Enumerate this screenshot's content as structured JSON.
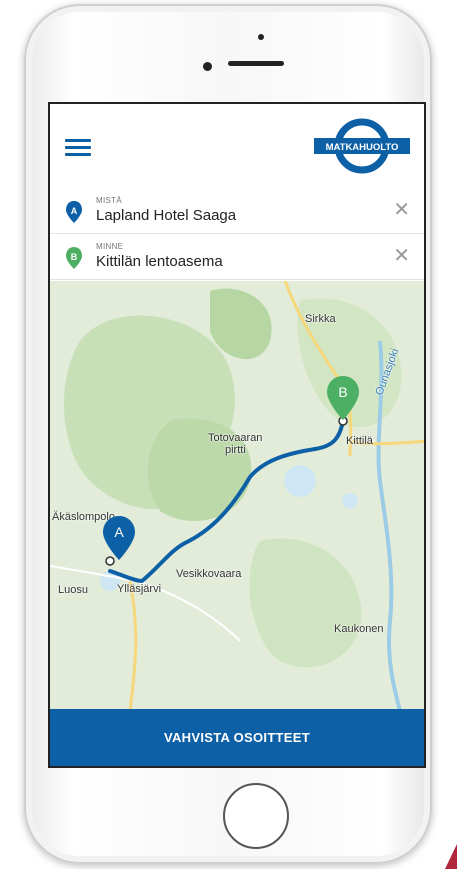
{
  "header": {
    "logo_text": "MATKAHUOLTO",
    "brand_color": "#0d5fa6"
  },
  "from": {
    "marker": "A",
    "label": "MISTÄ",
    "value": "Lapland Hotel Saaga",
    "clear": "✕",
    "pin_color": "#0d5fa6"
  },
  "to": {
    "marker": "B",
    "label": "MINNE",
    "value": "Kittilän lentoasema",
    "clear": "✕",
    "pin_color": "#4caf63"
  },
  "map": {
    "places": {
      "sirkka": "Sirkka",
      "ounasjoki": "Ounasjoki",
      "totovaaran": "Totovaaran",
      "pirtti": "pirtti",
      "kittila": "Kittilä",
      "akaslompolo": "Äkäslompolo",
      "vesikkovaara": "Vesikkovaara",
      "luosu": "Luosu",
      "ylläsjärvi": "Ylläsjärvi",
      "kaukonen": "Kaukonen"
    },
    "marker_a": "A",
    "marker_b": "B",
    "route_color": "#0d5fa6"
  },
  "confirm_button": "VAHVISTA OSOITTEET"
}
